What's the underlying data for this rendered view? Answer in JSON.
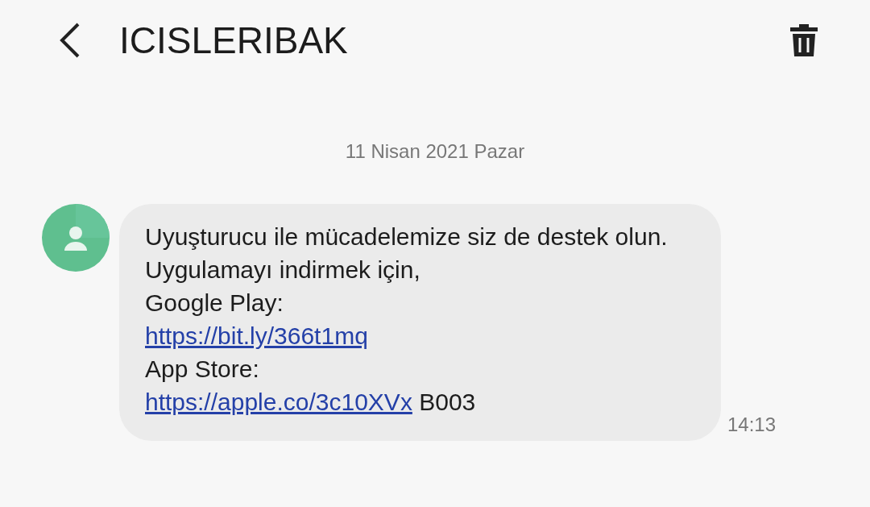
{
  "header": {
    "title": "ICISLERIBAK"
  },
  "date": "11 Nisan 2021 Pazar",
  "message": {
    "time": "14:13",
    "lines": [
      {
        "segments": [
          {
            "kind": "text",
            "text": "Uyuşturucu ile mücadelemize siz de destek olun."
          }
        ]
      },
      {
        "segments": [
          {
            "kind": "text",
            "text": "Uygulamayı indirmek için,"
          }
        ]
      },
      {
        "segments": [
          {
            "kind": "text",
            "text": "Google Play:"
          }
        ]
      },
      {
        "segments": [
          {
            "kind": "link",
            "text": "https://bit.ly/366t1mq"
          }
        ]
      },
      {
        "segments": [
          {
            "kind": "text",
            "text": "App Store:"
          }
        ]
      },
      {
        "segments": [
          {
            "kind": "link",
            "text": "https://apple.co/3c10XVx"
          },
          {
            "kind": "text",
            "text": " B003"
          }
        ]
      }
    ]
  }
}
